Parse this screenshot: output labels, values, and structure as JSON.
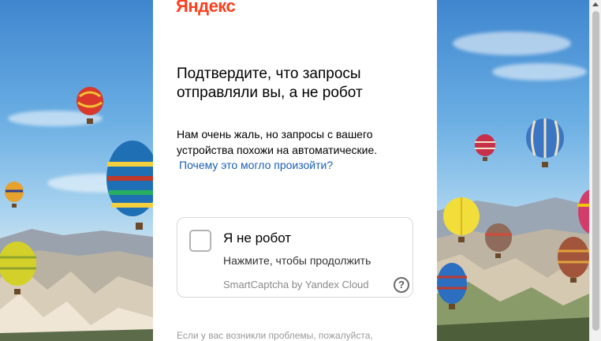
{
  "brand": {
    "logo_text": "Яндекс",
    "logo_color": "#fc3f1d"
  },
  "page": {
    "title": "Подтвердите, что запросы отправляли вы, а не робот",
    "description": "Нам очень жаль, но запросы с вашего устройства похожи на автоматические.",
    "why_link": "Почему это могло произойти?",
    "link_color": "#1a5fb4"
  },
  "captcha": {
    "checkbox_label": "Я не робот",
    "subtitle": "Нажмите, чтобы продолжить",
    "provider": "SmartCaptcha by Yandex Cloud",
    "help_icon": "question-circle-icon",
    "help_glyph": "?"
  },
  "footer": {
    "text": "Если у вас возникли проблемы, пожалуйста,"
  },
  "background": {
    "theme": "hot-air-balloons-cappadocia"
  }
}
